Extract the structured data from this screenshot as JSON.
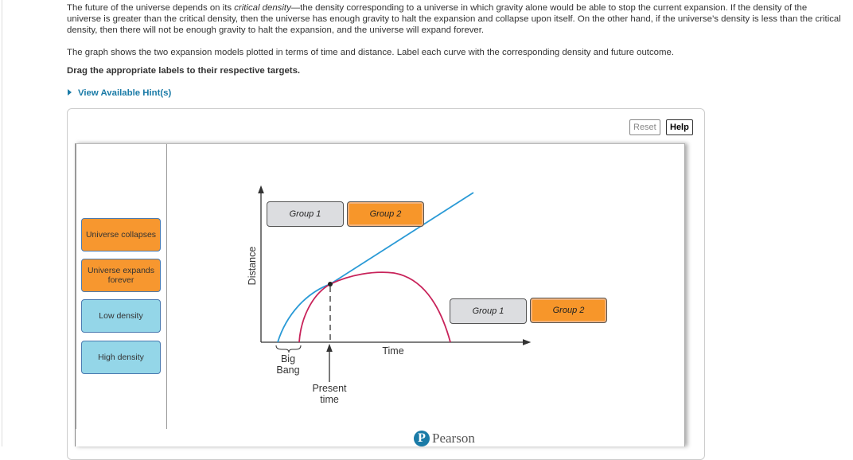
{
  "intro": {
    "before_term": "The future of the universe depends on its ",
    "term": "critical density",
    "after_term": "—the density corresponding to a universe in which gravity alone would be able to stop the current expansion. If the density of the universe is greater than the critical density, then the universe has enough gravity to halt the expansion and collapse upon itself. On the other hand, if the universe’s density is less than the critical density, then there will not be enough gravity to halt the expansion, and the universe will expand forever."
  },
  "instructions": "The graph shows the two expansion models plotted in terms of time and distance. Label each curve with the corresponding density and future outcome.",
  "drag_prompt": "Drag the appropriate labels to their respective targets.",
  "hint_link": "View Available Hint(s)",
  "toolbar": {
    "reset_label": "Reset",
    "help_label": "Help"
  },
  "label_bank": [
    {
      "text": "Universe collapses",
      "color": "#f7972f"
    },
    {
      "text": "Universe expands forever",
      "color": "#f7972f"
    },
    {
      "text": "Low density",
      "color": "#94d6e8"
    },
    {
      "text": "High density",
      "color": "#94d6e8"
    }
  ],
  "targets": {
    "upper": [
      {
        "text": "Group 1"
      },
      {
        "text": "Group 2"
      }
    ],
    "lower": [
      {
        "text": "Group 1"
      },
      {
        "text": "Group 2"
      }
    ]
  },
  "diagram": {
    "y_axis_label": "Distance",
    "x_axis_label": "Time",
    "big_bang_label_line1": "Big",
    "big_bang_label_line2": "Bang",
    "present_label_line1": "Present",
    "present_label_line2": "time",
    "expanding_curve_color": "#2a9ad6",
    "collapsing_curve_color": "#c8235a"
  },
  "footer": {
    "brand": "Pearson",
    "logo_letter": "P"
  }
}
